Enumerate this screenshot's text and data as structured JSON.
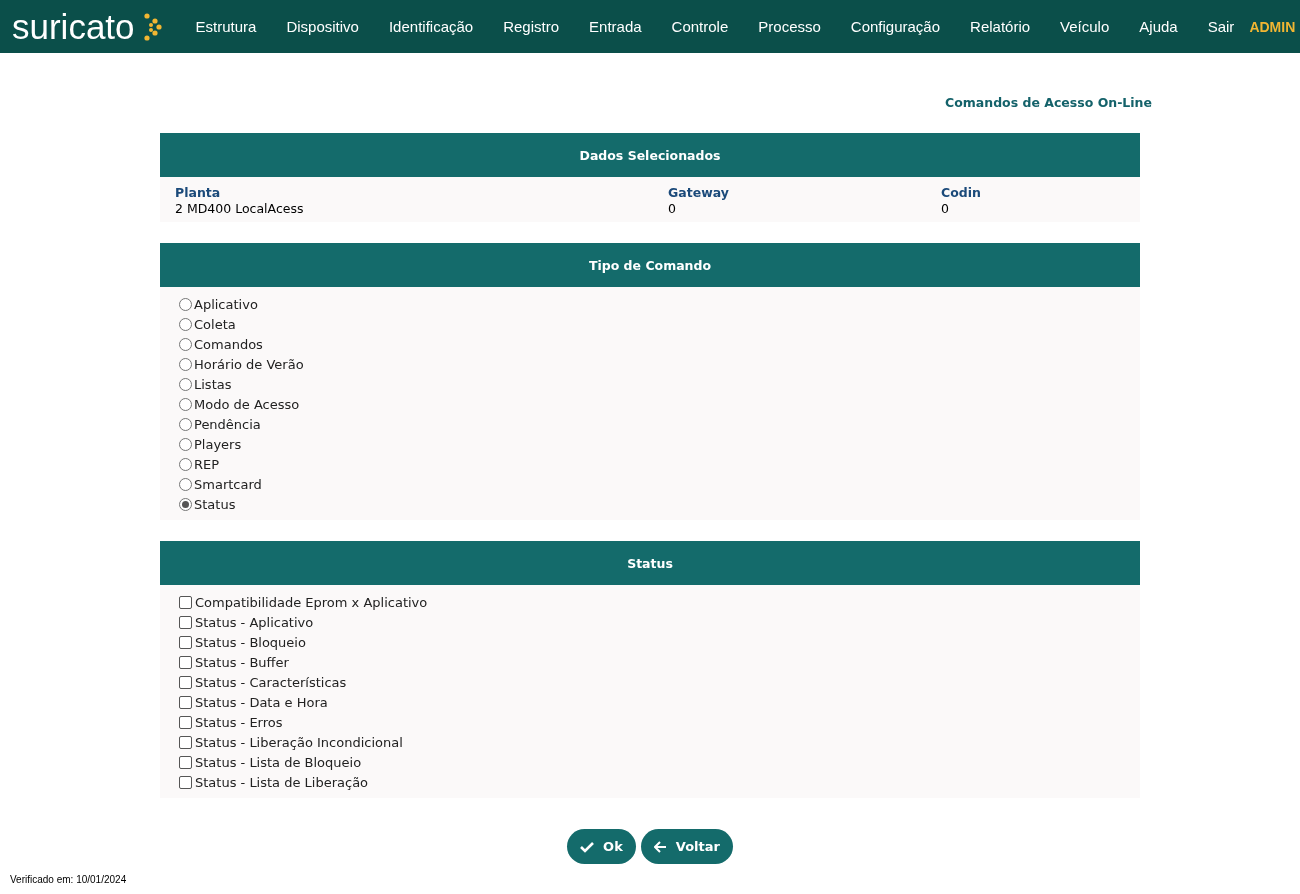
{
  "header": {
    "logo": "suricato",
    "menu": [
      "Estrutura",
      "Dispositivo",
      "Identificação",
      "Registro",
      "Entrada",
      "Controle",
      "Processo",
      "Configuração",
      "Relatório",
      "Veículo",
      "Ajuda",
      "Sair"
    ],
    "user": "ADMIN"
  },
  "page_title": "Comandos de Acesso On-Line",
  "selected_data": {
    "title": "Dados Selecionados",
    "fields": [
      {
        "label": "Planta",
        "value": "2 MD400 LocalAcess"
      },
      {
        "label": "Gateway",
        "value": "0"
      },
      {
        "label": "Codin",
        "value": "0"
      }
    ]
  },
  "command_type": {
    "title": "Tipo de Comando",
    "options": [
      {
        "label": "Aplicativo",
        "selected": false
      },
      {
        "label": "Coleta",
        "selected": false
      },
      {
        "label": "Comandos",
        "selected": false
      },
      {
        "label": "Horário de Verão",
        "selected": false
      },
      {
        "label": "Listas",
        "selected": false
      },
      {
        "label": "Modo de Acesso",
        "selected": false
      },
      {
        "label": "Pendência",
        "selected": false
      },
      {
        "label": "Players",
        "selected": false
      },
      {
        "label": "REP",
        "selected": false
      },
      {
        "label": "Smartcard",
        "selected": false
      },
      {
        "label": "Status",
        "selected": true
      }
    ]
  },
  "status": {
    "title": "Status",
    "options": [
      {
        "label": "Compatibilidade Eprom x Aplicativo",
        "checked": false
      },
      {
        "label": "Status - Aplicativo",
        "checked": false
      },
      {
        "label": "Status - Bloqueio",
        "checked": false
      },
      {
        "label": "Status - Buffer",
        "checked": false
      },
      {
        "label": "Status - Características",
        "checked": false
      },
      {
        "label": "Status - Data e Hora",
        "checked": false
      },
      {
        "label": "Status - Erros",
        "checked": false
      },
      {
        "label": "Status - Liberação Incondicional",
        "checked": false
      },
      {
        "label": "Status - Lista de Bloqueio",
        "checked": false
      },
      {
        "label": "Status - Lista de Liberação",
        "checked": false
      }
    ]
  },
  "buttons": [
    {
      "label": "Ok",
      "kind": "confirm"
    },
    {
      "label": "Voltar",
      "kind": "back"
    }
  ],
  "footer": "Verificado em: 10/01/2024"
}
